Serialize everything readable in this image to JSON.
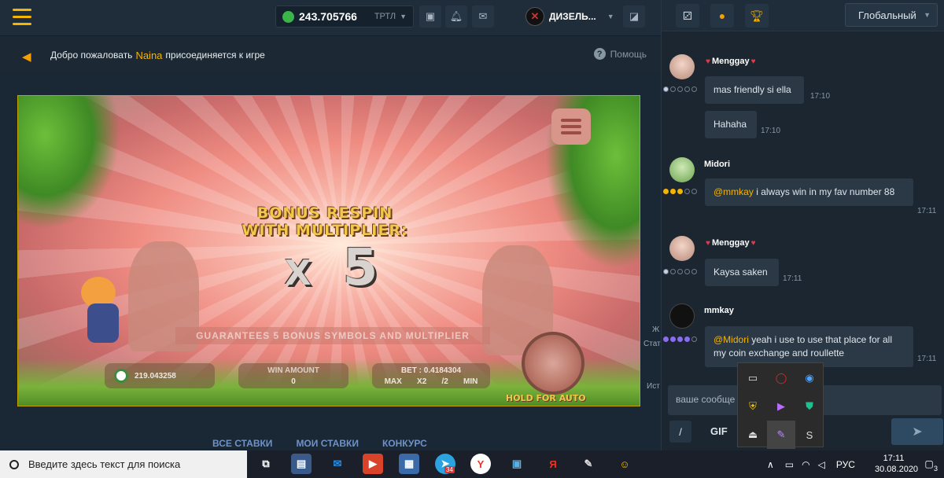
{
  "header": {
    "balance": "243.705766",
    "currency": "ТРТЛ",
    "username": "ДИЗЕЛЬ..."
  },
  "announcement": {
    "prefix": "Добро пожаловать",
    "name": "Naina",
    "suffix": "присоединяется к игре",
    "help": "Помощь"
  },
  "game": {
    "bonus_title_1": "BONUS RESPIN",
    "bonus_title_2": "WITH MULTIPLIER:",
    "mult_x": "X",
    "mult_value": "5",
    "guarantee": "GUARANTEES 5 BONUS SYMBOLS AND MULTIPLIER",
    "balance": "219.043258",
    "win_label": "WIN AMOUNT",
    "win_value": "0",
    "bet_label": "BET :",
    "bet_value": "0.4184304",
    "bet_buttons": [
      "MAX",
      "X2",
      "/2",
      "MIN"
    ],
    "hold_for_auto": "HOLD FOR AUTO"
  },
  "tabs": [
    "ВСЕ СТАВКИ",
    "МОИ СТАВКИ",
    "КОНКУРС"
  ],
  "chat": {
    "channel": "Глобальный",
    "messages": [
      {
        "user": "Menggay",
        "text": "mas friendly si ella",
        "time": "17:10"
      },
      {
        "user": "",
        "text": "Hahaha",
        "time": "17:10"
      },
      {
        "user": "Midori",
        "mention": "@mmkay",
        "text": "i always win in my fav number 88",
        "time": "17:11"
      },
      {
        "user": "Menggay",
        "text": "Kaysa saken",
        "time": "17:11"
      },
      {
        "user": "mmkay",
        "mention": "@Midori",
        "text": "yeah i use to use that place for all my coin exchange and roullette",
        "time": "17:11"
      }
    ],
    "input_placeholder": "ваше сообще",
    "cmd_label": "/",
    "gif_label": "GIF",
    "side_labels": [
      "Ж",
      "Стат",
      "Ист"
    ]
  },
  "taskbar": {
    "search_placeholder": "Введите здесь текст для поиска",
    "telegram_badge": "34",
    "lang": "РУС",
    "time": "17:11",
    "date": "30.08.2020",
    "notif_count": "3"
  },
  "colors": {
    "accent": "#f5b400",
    "bg": "#1a2734",
    "chat_bubble": "#2b3947",
    "link_blue": "#6f93c9"
  }
}
